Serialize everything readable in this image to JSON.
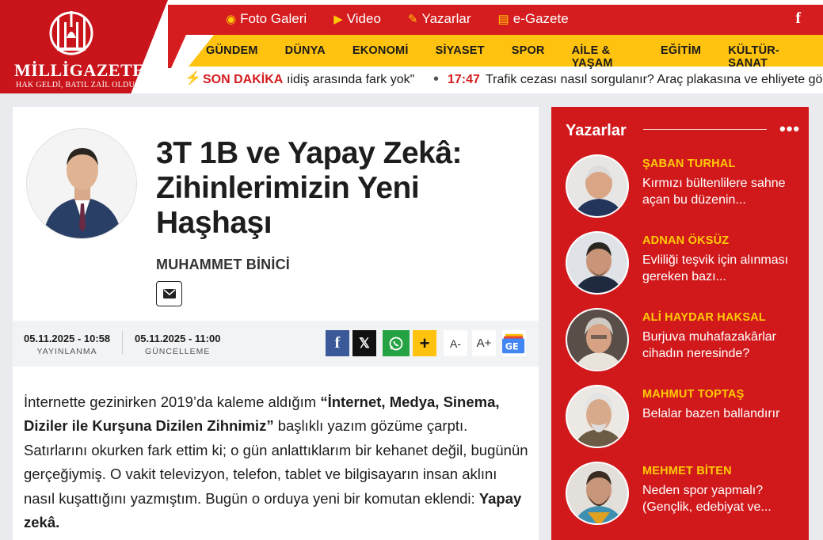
{
  "header": {
    "logo_text": "MİLLİGAZETE",
    "logo_slogan": "HAK GELDİ, BATIL ZAİL OLDU",
    "top_links": [
      {
        "label": "Foto Galeri",
        "icon": "camera-icon"
      },
      {
        "label": "Video",
        "icon": "video-icon"
      },
      {
        "label": "Yazarlar",
        "icon": "pen-icon"
      },
      {
        "label": "e-Gazete",
        "icon": "newspaper-icon"
      }
    ],
    "facebook": "f",
    "categories": [
      "GÜNDEM",
      "DÜNYA",
      "EKONOMİ",
      "SİYASET",
      "SPOR",
      "AİLE & YAŞAM",
      "EĞİTİM",
      "KÜLTÜR-SANAT"
    ],
    "ticker": {
      "label": "SON DAKİKA",
      "item1": "ıidiş arasında fark yok\"",
      "item2_time": "17:47",
      "item2_text": "Trafik cezası nasıl sorgulanır? Araç plakasına ve ehliyete göre ceza sorgulama"
    }
  },
  "article": {
    "title": "3T 1B ve Yapay Zekâ: Zihinlerimizin Yeni Haşhaşı",
    "author": "MUHAMMET BİNİCİ",
    "published_value": "05.11.2025 - 10:58",
    "published_label": "YAYINLANMA",
    "updated_value": "05.11.2025 - 11:00",
    "updated_label": "GÜNCELLEME",
    "share": {
      "facebook": "f",
      "x": "𝕏",
      "plus": "+",
      "font_smaller": "A-",
      "font_larger": "A+"
    },
    "body_p1_start": "İnternette gezinirken 2019’da kaleme aldığım ",
    "body_p1_bold": "“İnternet, Medya, Sinema, Diziler ile Kurşuna Dizilen Zihnimiz”",
    "body_p1_mid": " başlıklı yazım gözüme çarptı. Satırlarını okurken fark ettim ki; o gün anlattıklarım bir kehanet değil, bugünün gerçeğiymiş. O vakit televizyon, telefon, tablet ve bilgisayarın insan aklını nasıl kuşattığını yazmıştım. Bugün o orduya yeni bir komutan eklendi: ",
    "body_p1_end_bold": "Yapay zekâ."
  },
  "sidebar": {
    "title": "Yazarlar",
    "more": "•••",
    "writers": [
      {
        "name": "ŞABAN TURHAL",
        "text": "Kırmızı bültenlilere sahne açan bu düzenin..."
      },
      {
        "name": "ADNAN ÖKSÜZ",
        "text": "Evliliği teşvik için alınması gereken bazı..."
      },
      {
        "name": "ALİ HAYDAR HAKSAL",
        "text": "Burjuva muhafazakârlar cihadın neresinde?"
      },
      {
        "name": "MAHMUT TOPTAŞ",
        "text": "Belalar bazen ballandırır"
      },
      {
        "name": "MEHMET BİTEN",
        "text": "Neden spor yapmalı? (Gençlik, edebiyat ve..."
      }
    ]
  },
  "colors": {
    "brand_red": "#d51c1e",
    "accent_yellow": "#ffc20e"
  }
}
